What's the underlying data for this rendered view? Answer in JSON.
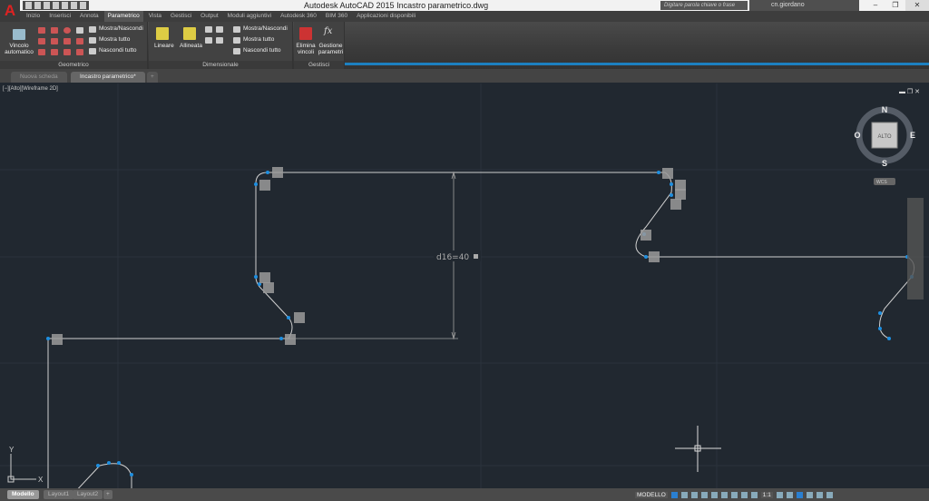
{
  "title": "Autodesk AutoCAD 2015    Incastro parametrico.dwg",
  "search_placeholder": "Digitare parola chiave o frase",
  "user": "cn.giordano",
  "ribbon_tabs": [
    "Inizio",
    "Inserisci",
    "Annota",
    "Parametrico",
    "Vista",
    "Gestisci",
    "Output",
    "Moduli aggiuntivi",
    "Autodesk 360",
    "BIM 360",
    "Applicazioni disponibili"
  ],
  "ribbon": {
    "geometrico": {
      "label": "Geometrico",
      "auto": "Vincolo automatico",
      "show": "Mostra/Nascondi",
      "showall": "Mostra tutto",
      "hideall": "Nascondi tutto"
    },
    "dimensionale": {
      "label": "Dimensionale",
      "lineare": "Lineare",
      "allineata": "Allineata",
      "show": "Mostra/Nascondi",
      "showall": "Mostra tutto",
      "hideall": "Nascondi tutto"
    },
    "gestisci": {
      "label": "Gestisci",
      "elimina": "Elimina vincoli",
      "gestione": "Gestione parametri"
    }
  },
  "doc_tabs": [
    "Nuova scheda",
    "Incastro parametrico*"
  ],
  "viewport_label": "[−][Alto][Wireframe 2D]",
  "viewcube": {
    "top": "ALTO",
    "n": "N",
    "s": "S",
    "e": "E",
    "w": "O",
    "wcs": "WCS"
  },
  "dimension": "d16=40",
  "ucs": {
    "x": "X",
    "y": "Y"
  },
  "layout_tabs": [
    "Modello",
    "Layout1",
    "Layout2"
  ],
  "status": {
    "mode": "MODELLO",
    "scale": "1:1"
  },
  "colors": {
    "grip": "#1e8fe0",
    "line": "#d0d0d0",
    "background": "#212830"
  }
}
